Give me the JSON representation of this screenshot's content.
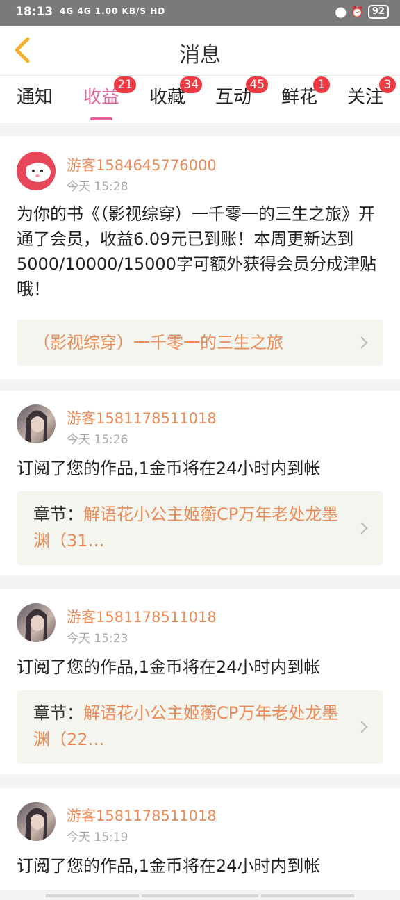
{
  "status_bar": {
    "time": "18:13",
    "signals": "4G 4G 1.00 KB/S HD",
    "battery": "92"
  },
  "header": {
    "title": "消息"
  },
  "tabs": [
    {
      "label": "通知",
      "badge": ""
    },
    {
      "label": "收益",
      "badge": "21",
      "active": true
    },
    {
      "label": "收藏",
      "badge": "34"
    },
    {
      "label": "互动",
      "badge": "45"
    },
    {
      "label": "鲜花",
      "badge": "1"
    },
    {
      "label": "关注",
      "badge": "3"
    }
  ],
  "messages": [
    {
      "user": "游客1584645776000",
      "time": "今天 15:28",
      "text": "为你的书《（影视综穿）一千零一的三生之旅》开通了会员，收益6.09元已到账！本周更新达到5000/10000/15000字可额外获得会员分成津贴哦！",
      "link_prefix": "",
      "link": "（影视综穿）一千零一的三生之旅"
    },
    {
      "user": "游客1581178511018",
      "time": "今天 15:26",
      "text": "订阅了您的作品,1金币将在24小时内到帐",
      "link_prefix": "章节：",
      "link": "解语花小公主姬蘅CP万年老处龙墨渊（31…"
    },
    {
      "user": "游客1581178511018",
      "time": "今天 15:23",
      "text": "订阅了您的作品,1金币将在24小时内到帐",
      "link_prefix": "章节：",
      "link": "解语花小公主姬蘅CP万年老处龙墨渊（22…"
    },
    {
      "user": "游客1581178511018",
      "time": "今天 15:19",
      "text": "订阅了您的作品,1金币将在24小时内到帐"
    }
  ],
  "colors": {
    "accent": "#e0649b",
    "username": "#eb8a57",
    "badge": "#ee3b43"
  }
}
